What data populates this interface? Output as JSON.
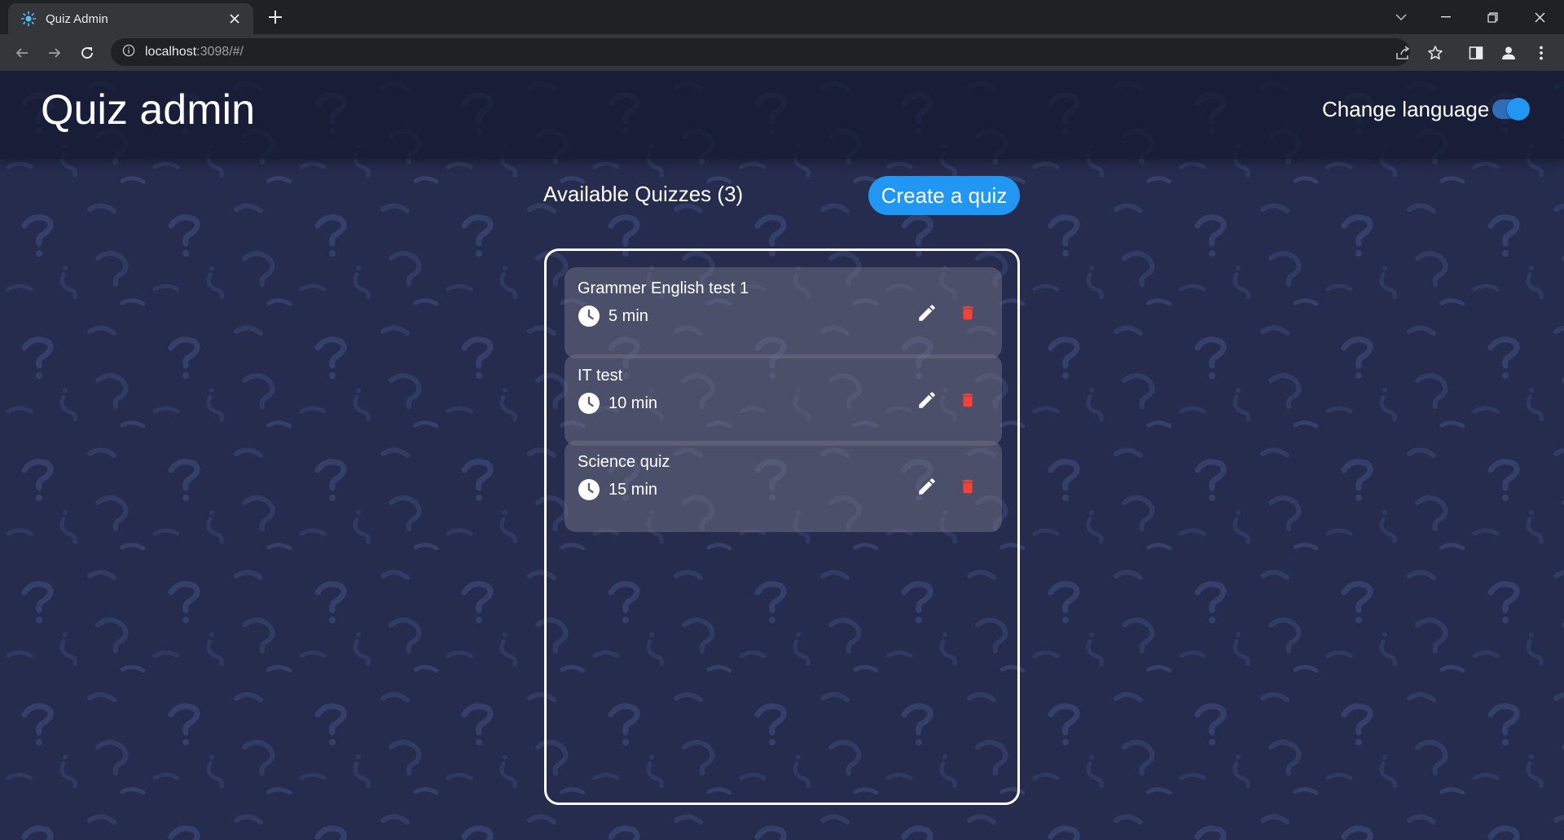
{
  "browser": {
    "tab_title": "Quiz Admin",
    "url_host": "localhost",
    "url_rest": ":3098/#/",
    "tab_close_icon": "close-icon",
    "new_tab_icon": "plus-icon"
  },
  "app": {
    "title": "Quiz admin",
    "change_language_label": "Change language",
    "language_toggle_on": true
  },
  "main": {
    "heading": "Available Quizzes (3)",
    "create_button_label": "Create a quiz",
    "quizzes": [
      {
        "name": "Grammer English test 1",
        "duration": "5 min"
      },
      {
        "name": "IT test",
        "duration": "10 min"
      },
      {
        "name": "Science quiz",
        "duration": "15 min"
      }
    ]
  },
  "colors": {
    "accent": "#2196f3",
    "background": "#252c4e",
    "delete": "#f44336",
    "card": "#5a5d72"
  }
}
